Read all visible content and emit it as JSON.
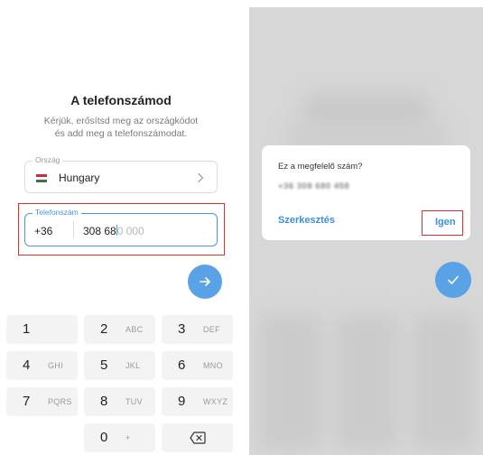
{
  "left": {
    "title": "A telefonszámod",
    "subtitle_line1": "Kérjük, erősítsd meg az országkódot",
    "subtitle_line2": "és add meg a telefonszámodat.",
    "country": {
      "label": "Ország",
      "value": "Hungary"
    },
    "phone": {
      "label": "Telefonszám",
      "prefix": "+36",
      "typed": "308 68",
      "placeholder": "0 000"
    },
    "keypad": [
      {
        "digit": "1",
        "letters": ""
      },
      {
        "digit": "2",
        "letters": "ABC"
      },
      {
        "digit": "3",
        "letters": "DEF"
      },
      {
        "digit": "4",
        "letters": "GHI"
      },
      {
        "digit": "5",
        "letters": "JKL"
      },
      {
        "digit": "6",
        "letters": "MNO"
      },
      {
        "digit": "7",
        "letters": "PQRS"
      },
      {
        "digit": "8",
        "letters": "TUV"
      },
      {
        "digit": "9",
        "letters": "WXYZ"
      },
      {
        "digit": "0",
        "letters": "+"
      }
    ]
  },
  "right": {
    "dialog": {
      "question": "Ez a megfelelő szám?",
      "number": "+36 308 680 458",
      "edit_label": "Szerkesztés",
      "confirm_label": "Igen"
    }
  },
  "colors": {
    "accent": "#4a97e0",
    "highlight": "#d9302c"
  }
}
